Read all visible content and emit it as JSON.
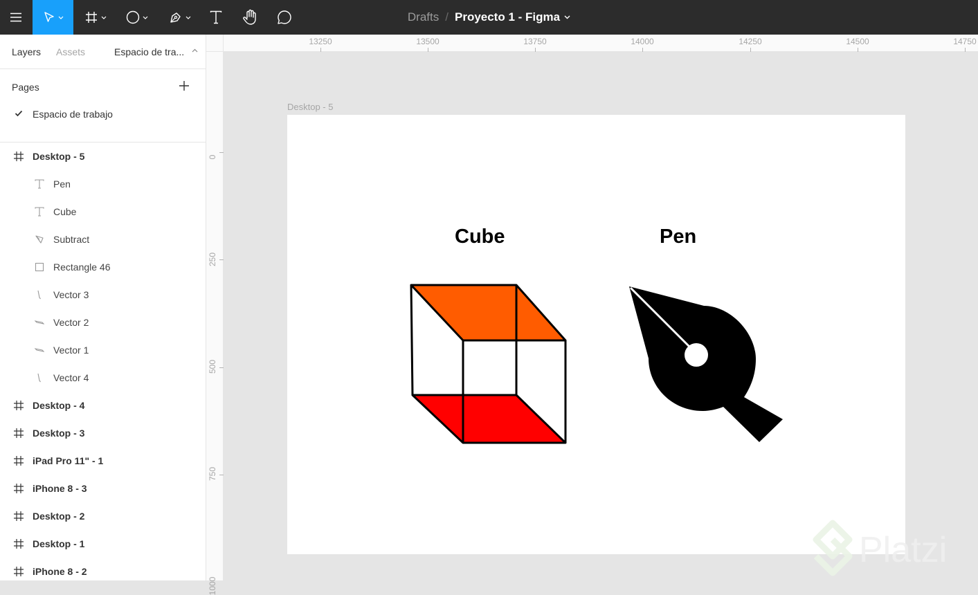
{
  "toolbar": {
    "breadcrumb": "Drafts",
    "separator": "/",
    "filename": "Proyecto 1 - Figma",
    "tools": [
      "menu-icon",
      "move-icon",
      "frame-icon",
      "ellipse-icon",
      "pen-icon",
      "text-icon",
      "hand-icon",
      "comment-icon"
    ]
  },
  "left_panel": {
    "tabs": [
      "Layers",
      "Assets"
    ],
    "current_page": "Espacio de tra...",
    "pages_header": "Pages",
    "pages": [
      "Espacio de trabajo"
    ],
    "layers": [
      {
        "name": "Desktop - 5",
        "type": "frame"
      },
      {
        "name": "Pen",
        "type": "text"
      },
      {
        "name": "Cube",
        "type": "text"
      },
      {
        "name": "Subtract",
        "type": "vector"
      },
      {
        "name": "Rectangle 46",
        "type": "rectangle"
      },
      {
        "name": "Vector 3",
        "type": "vector"
      },
      {
        "name": "Vector 2",
        "type": "vector"
      },
      {
        "name": "Vector 1",
        "type": "vector"
      },
      {
        "name": "Vector 4",
        "type": "vector"
      },
      {
        "name": "Desktop - 4",
        "type": "frame"
      },
      {
        "name": "Desktop - 3",
        "type": "frame"
      },
      {
        "name": "iPad Pro 11\" - 1",
        "type": "frame"
      },
      {
        "name": "iPhone 8 - 3",
        "type": "frame"
      },
      {
        "name": "Desktop - 2",
        "type": "frame"
      },
      {
        "name": "Desktop - 1",
        "type": "frame"
      },
      {
        "name": "iPhone 8 - 2",
        "type": "frame"
      }
    ]
  },
  "rulers": {
    "top": [
      "13250",
      "13500",
      "13750",
      "14000",
      "14250",
      "14500",
      "14750"
    ],
    "left": [
      "0",
      "250",
      "500",
      "750",
      "1000"
    ]
  },
  "canvas": {
    "frame_label": "Desktop - 5",
    "cube_label": "Cube",
    "pen_label": "Pen",
    "cube_top_color": "#ff5c00",
    "cube_bottom_color": "#ff0000"
  },
  "watermark": "Platzi",
  "colors": {
    "toolbar_bg": "#2c2c2c",
    "accent": "#18a0fb"
  }
}
